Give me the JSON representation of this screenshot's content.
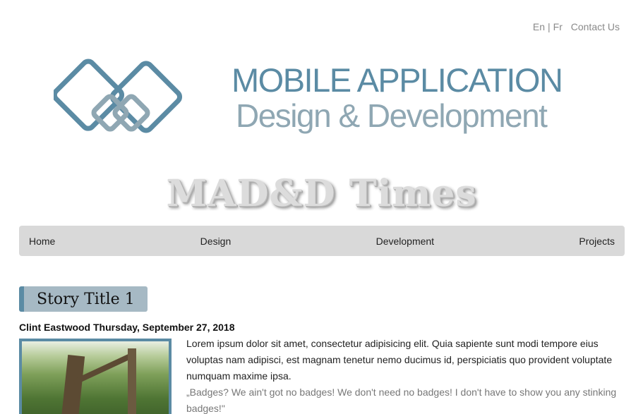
{
  "header": {
    "lang_en": "En",
    "lang_sep": "|",
    "lang_fr": "Fr",
    "contact": "Contact Us"
  },
  "logo": {
    "line1": "MOBILE APPLICATION",
    "line2": "Design & Development",
    "icon": "chain-link-diamond-logo",
    "colors": {
      "primary": "#5b8ba4",
      "secondary": "#8fa7b3"
    }
  },
  "masthead": {
    "title": "MAD&D Times"
  },
  "nav": {
    "items": [
      {
        "label": "Home"
      },
      {
        "label": "Design"
      },
      {
        "label": "Development"
      },
      {
        "label": "Projects"
      }
    ]
  },
  "story": {
    "title": "Story Title 1",
    "byline": "Clint Eastwood Thursday, September 27, 2018",
    "paragraph": "Lorem ipsum dolor sit amet, consectetur adipisicing elit. Quia sapiente sunt modi tempore eius voluptas nam adipisci, est magnam tenetur nemo ducimus id, perspiciatis quo provident voluptate numquam maxime ipsa.",
    "quote": "„Badges? We ain't got no badges! We don't need no badges! I don't have to show you any stinking badges!\""
  }
}
